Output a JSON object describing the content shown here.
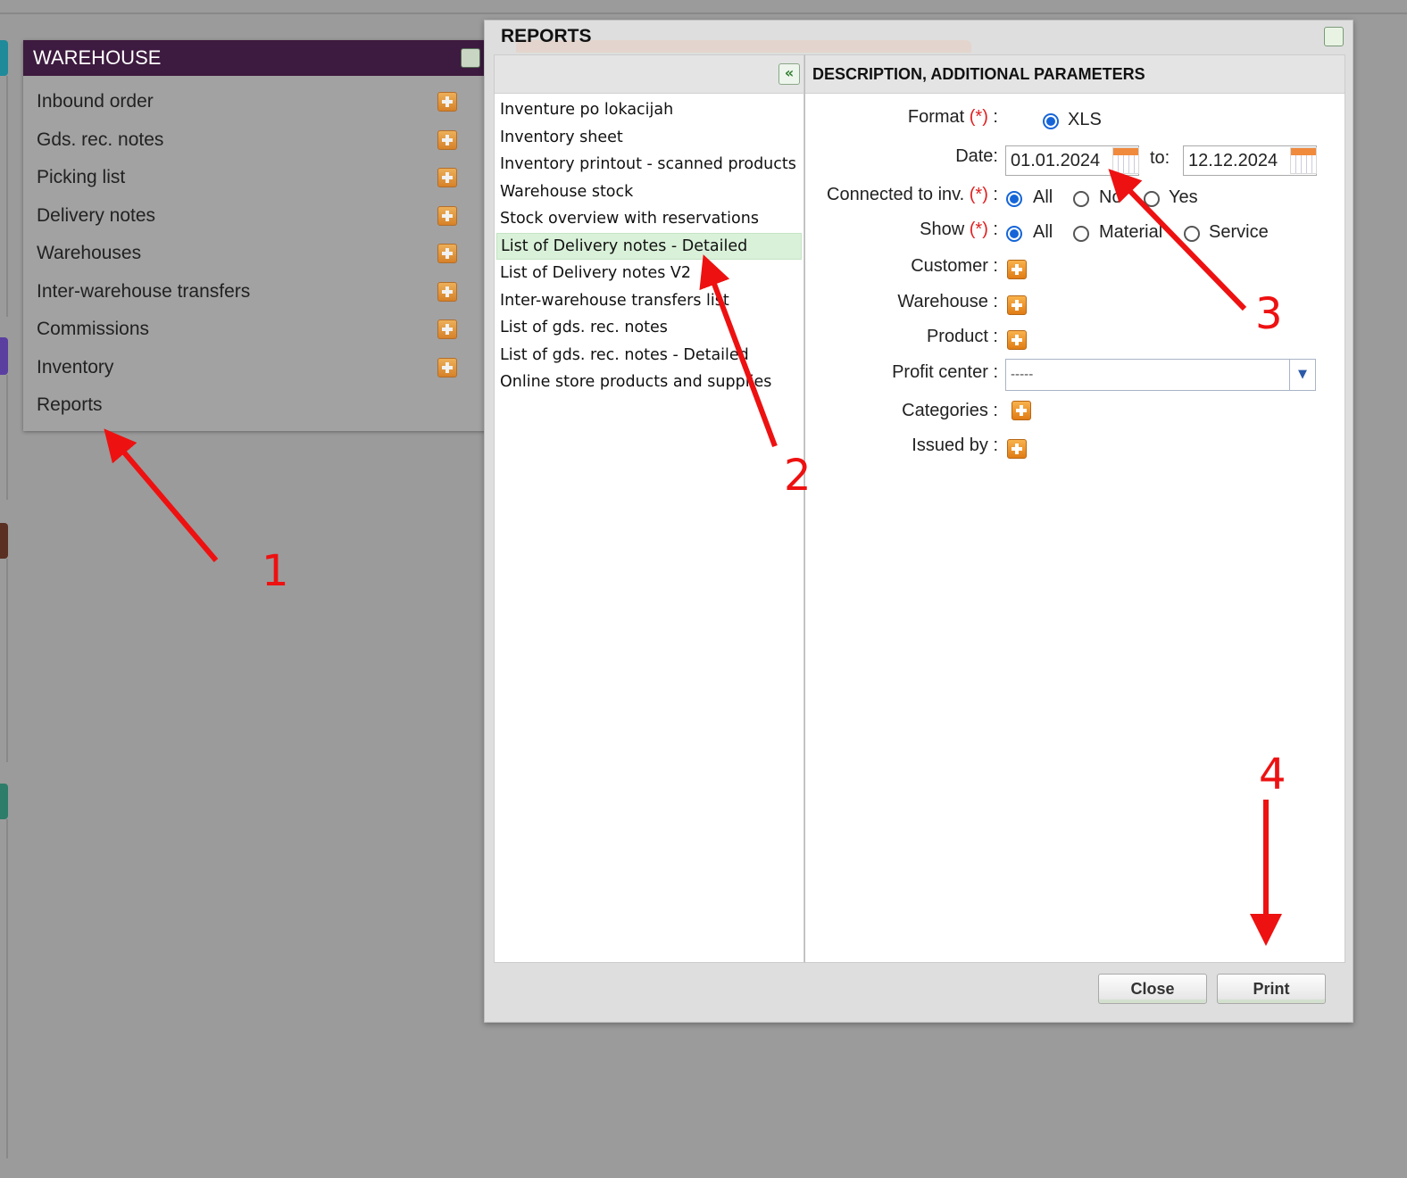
{
  "warehouse": {
    "title": "WAREHOUSE",
    "items": [
      {
        "label": "Inbound order",
        "has_add": true
      },
      {
        "label": "Gds. rec. notes",
        "has_add": true
      },
      {
        "label": "Picking list",
        "has_add": true
      },
      {
        "label": "Delivery notes",
        "has_add": true
      },
      {
        "label": "Warehouses",
        "has_add": true
      },
      {
        "label": "Inter-warehouse transfers",
        "has_add": true
      },
      {
        "label": "Commissions",
        "has_add": true
      },
      {
        "label": "Inventory",
        "has_add": true
      },
      {
        "label": "Reports",
        "has_add": false
      }
    ]
  },
  "reports": {
    "title": "REPORTS",
    "params_header": "DESCRIPTION, ADDITIONAL PARAMETERS",
    "list": [
      "Inventure po lokacijah",
      "Inventory sheet",
      "Inventory printout - scanned products",
      "Warehouse stock",
      "Stock overview with reservations",
      "List of Delivery notes - Detailed",
      "List of Delivery notes V2",
      "Inter-warehouse transfers list",
      "List of gds. rec. notes",
      "List of gds. rec. notes - Detailed",
      "Online store products and supplies"
    ],
    "selected_index": 5,
    "form": {
      "format_label": "Format",
      "format_option": "XLS",
      "date_label": "Date:",
      "date_from": "01.01.2024",
      "to_label": "to:",
      "date_to": "12.12.2024",
      "connected_label": "Connected to inv.",
      "connected_options": [
        "All",
        "No",
        "Yes"
      ],
      "show_label": "Show",
      "show_options": [
        "All",
        "Material",
        "Service"
      ],
      "customer_label": "Customer :",
      "warehouse_label": "Warehouse :",
      "product_label": "Product :",
      "profit_center_label": "Profit center :",
      "profit_center_value": "-----",
      "categories_label": "Categories :",
      "issued_by_label": "Issued by :",
      "req_mark": "(*)",
      "colon": " :"
    },
    "buttons": {
      "close": "Close",
      "print": "Print"
    }
  },
  "annotations": [
    "1",
    "2",
    "3",
    "4"
  ],
  "colors": {
    "accent": "#e11",
    "panel_header": "#3d1a3f",
    "selected_row": "#d9f1d9",
    "radio": "#1565d8"
  }
}
